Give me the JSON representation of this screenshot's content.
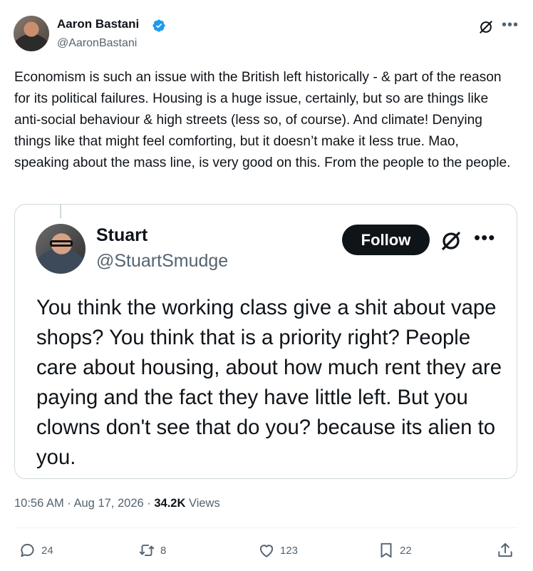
{
  "author": {
    "name": "Aaron Bastani",
    "handle": "@AaronBastani",
    "verified": true
  },
  "icons": {
    "verified": "verified-badge-icon",
    "grok": "grok-icon",
    "more": "more-icon",
    "reply": "reply-icon",
    "repost": "repost-icon",
    "like": "like-icon",
    "bookmark": "bookmark-icon",
    "share": "share-icon"
  },
  "post": {
    "text": "Economism is such an issue with the British left historically - & part of the reason for its political failures. Housing is a huge issue, certainly, but so are things like anti-social behaviour & high streets (less so, of course). And climate! Denying things like that might feel comforting, but it doesn’t make it less true. Mao, speaking about the mass line, is very good on this. From the people to the people."
  },
  "quoted": {
    "name": "Stuart",
    "handle": "@StuartSmudge",
    "follow_label": "Follow",
    "text": "You think the working class give a shit about vape shops? You think that is a priority right? People care about housing, about how much rent they are paying and the fact they have little left. But you clowns don't see that do you? because its alien to you."
  },
  "meta": {
    "time": "10:56 AM",
    "sep1": "·",
    "date": "Aug 17, 2026",
    "sep2": "·",
    "views_count": "34.2K",
    "views_label": "Views"
  },
  "actions": {
    "replies": "24",
    "reposts": "8",
    "likes": "123",
    "bookmarks": "22"
  },
  "colors": {
    "text": "#0f1419",
    "secondary": "#536471",
    "verified": "#1d9bf0",
    "border": "#cfd9de"
  }
}
